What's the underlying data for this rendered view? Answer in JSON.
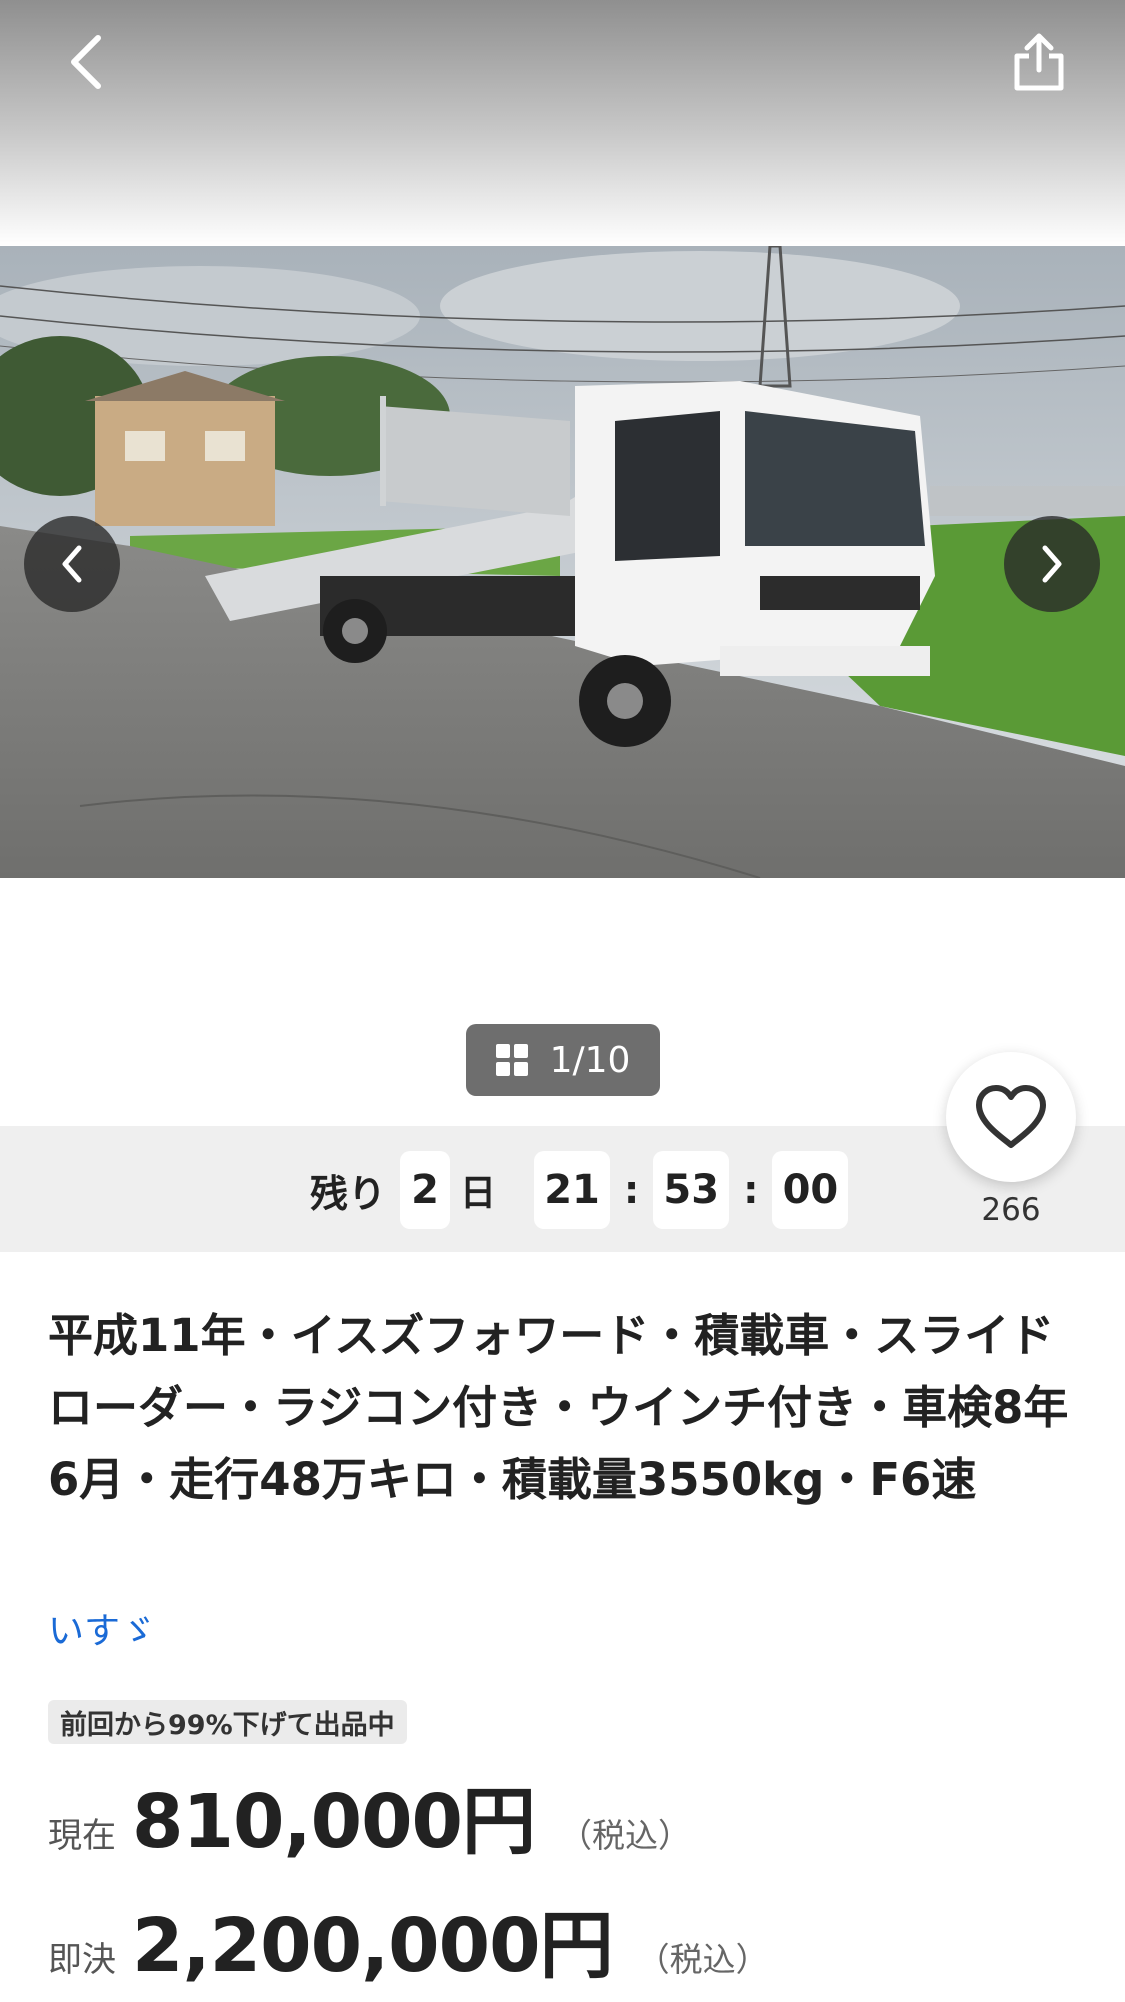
{
  "header": {
    "back_icon": "chevron-left-icon",
    "share_icon": "share-icon"
  },
  "gallery": {
    "prev_icon": "chevron-left-icon",
    "next_icon": "chevron-right-icon",
    "counter": "1/10",
    "counter_icon": "grid-icon"
  },
  "countdown": {
    "prefix": "残り",
    "days": "2",
    "days_unit": "日",
    "hours": "21",
    "minutes": "53",
    "seconds": "00",
    "separator": ":"
  },
  "favorite": {
    "icon": "heart-icon",
    "count": "266"
  },
  "listing": {
    "title": "平成11年・イスズフォワード・積載車・スライドローダー・ラジコン付き・ウインチ付き・車検8年6月・走行48万キロ・積載量3550kg・F6速",
    "maker": "いすゞ",
    "discount_badge": "前回から99%下げて出品中",
    "current_label": "現在",
    "current_price": "810,000円",
    "current_tax": "（税込）",
    "buyout_label": "即決",
    "buyout_price": "2,200,000円",
    "buyout_tax": "（税込）"
  },
  "colors": {
    "link": "#1a6ad6",
    "band": "#efefef",
    "counter_bg": "#6e6e6e"
  }
}
